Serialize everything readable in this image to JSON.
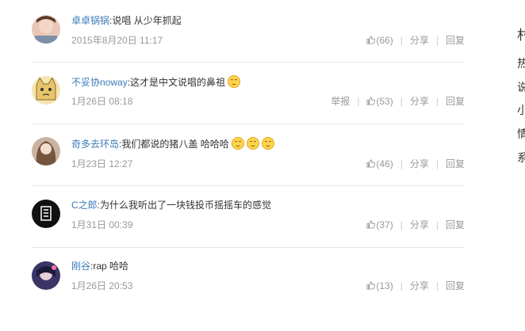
{
  "comments": [
    {
      "user": "卓卓锅锅",
      "text": "说唱 从少年抓起",
      "time": "2015年8月20日 11:17",
      "likes": "(66)",
      "report": "",
      "share": "分享",
      "reply": "回复",
      "emojis": 0
    },
    {
      "user": "不妥协noway",
      "text": "这才是中文说唱的鼻祖",
      "time": "1月26日 08:18",
      "likes": "(53)",
      "report": "举报",
      "share": "分享",
      "reply": "回复",
      "emojis": 1
    },
    {
      "user": "奇多去环岛",
      "text": "我们都说的猪八盖 哈哈哈",
      "time": "1月23日 12:27",
      "likes": "(46)",
      "report": "",
      "share": "分享",
      "reply": "回复",
      "emojis": 3
    },
    {
      "user": "C之郎",
      "text": "为什么我听出了一块钱投币摇摇车的感觉",
      "time": "1月31日 00:39",
      "likes": "(37)",
      "report": "",
      "share": "分享",
      "reply": "回复",
      "emojis": 0
    },
    {
      "user": "刚谷",
      "text": "rap 哈哈",
      "time": "1月26日 20:53",
      "likes": "(13)",
      "report": "",
      "share": "分享",
      "reply": "回复",
      "emojis": 0
    }
  ],
  "colon": ":",
  "sidebar_chars": [
    "村",
    "热",
    "说",
    "小",
    "情",
    "系"
  ],
  "colors": {
    "username": "#3a7ab8",
    "meta": "#999999",
    "divider": "#e6e6e6"
  }
}
